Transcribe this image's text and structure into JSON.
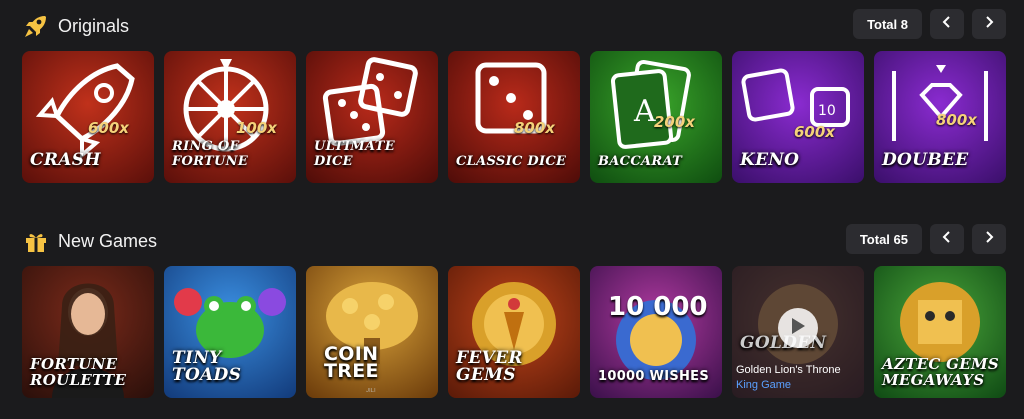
{
  "originals": {
    "title": "Originals",
    "icon": "rocket-icon",
    "total_label": "Total 8",
    "games": [
      {
        "name": "Crash",
        "multiplier": "600x",
        "bg1": "#c0311b",
        "bg2": "#5a0f0a"
      },
      {
        "name": "Ring of Fortune",
        "multiplier": "100x",
        "bg1": "#c0311b",
        "bg2": "#5a0f0a"
      },
      {
        "name": "Ultimate Dice",
        "multiplier": "",
        "bg1": "#b92a1a",
        "bg2": "#4e0c08"
      },
      {
        "name": "Classic Dice",
        "multiplier": "800x",
        "bg1": "#b92a1a",
        "bg2": "#4e0c08"
      },
      {
        "name": "Baccarat",
        "multiplier": "200x",
        "bg1": "#3aa52a",
        "bg2": "#0f4d10"
      },
      {
        "name": "Keno",
        "multiplier": "600x",
        "bg1": "#8a2bd0",
        "bg2": "#3a0f6a"
      },
      {
        "name": "Doubee",
        "multiplier": "800x",
        "bg1": "#8a2bd0",
        "bg2": "#3a0f6a"
      }
    ]
  },
  "new_games": {
    "title": "New Games",
    "icon": "gift-icon",
    "total_label": "Total 65",
    "games": [
      {
        "name": "Fortune Roulette",
        "bg1": "#7a2a1a",
        "bg2": "#2a0f0a"
      },
      {
        "name": "Tiny Toads",
        "bg1": "#3a8ee0",
        "bg2": "#123a7a"
      },
      {
        "name": "Coin Tree",
        "bg1": "#d9a23a",
        "bg2": "#6a3a0a"
      },
      {
        "name": "Fever Gems",
        "bg1": "#c0441a",
        "bg2": "#5a1a08"
      },
      {
        "name": "10000 Wishes",
        "bg1": "#b03aa0",
        "bg2": "#3a104a"
      },
      {
        "name": "Golden",
        "bg1": "#6a4a2a",
        "bg2": "#2a1a10"
      },
      {
        "name": "Aztec Gems Megaways",
        "bg1": "#4aa53a",
        "bg2": "#0f4a14"
      }
    ],
    "video_title": "Golden Lion's Throne",
    "video_provider": "King Game",
    "badge_10000": "10 000",
    "provider_jili": "JILI"
  }
}
